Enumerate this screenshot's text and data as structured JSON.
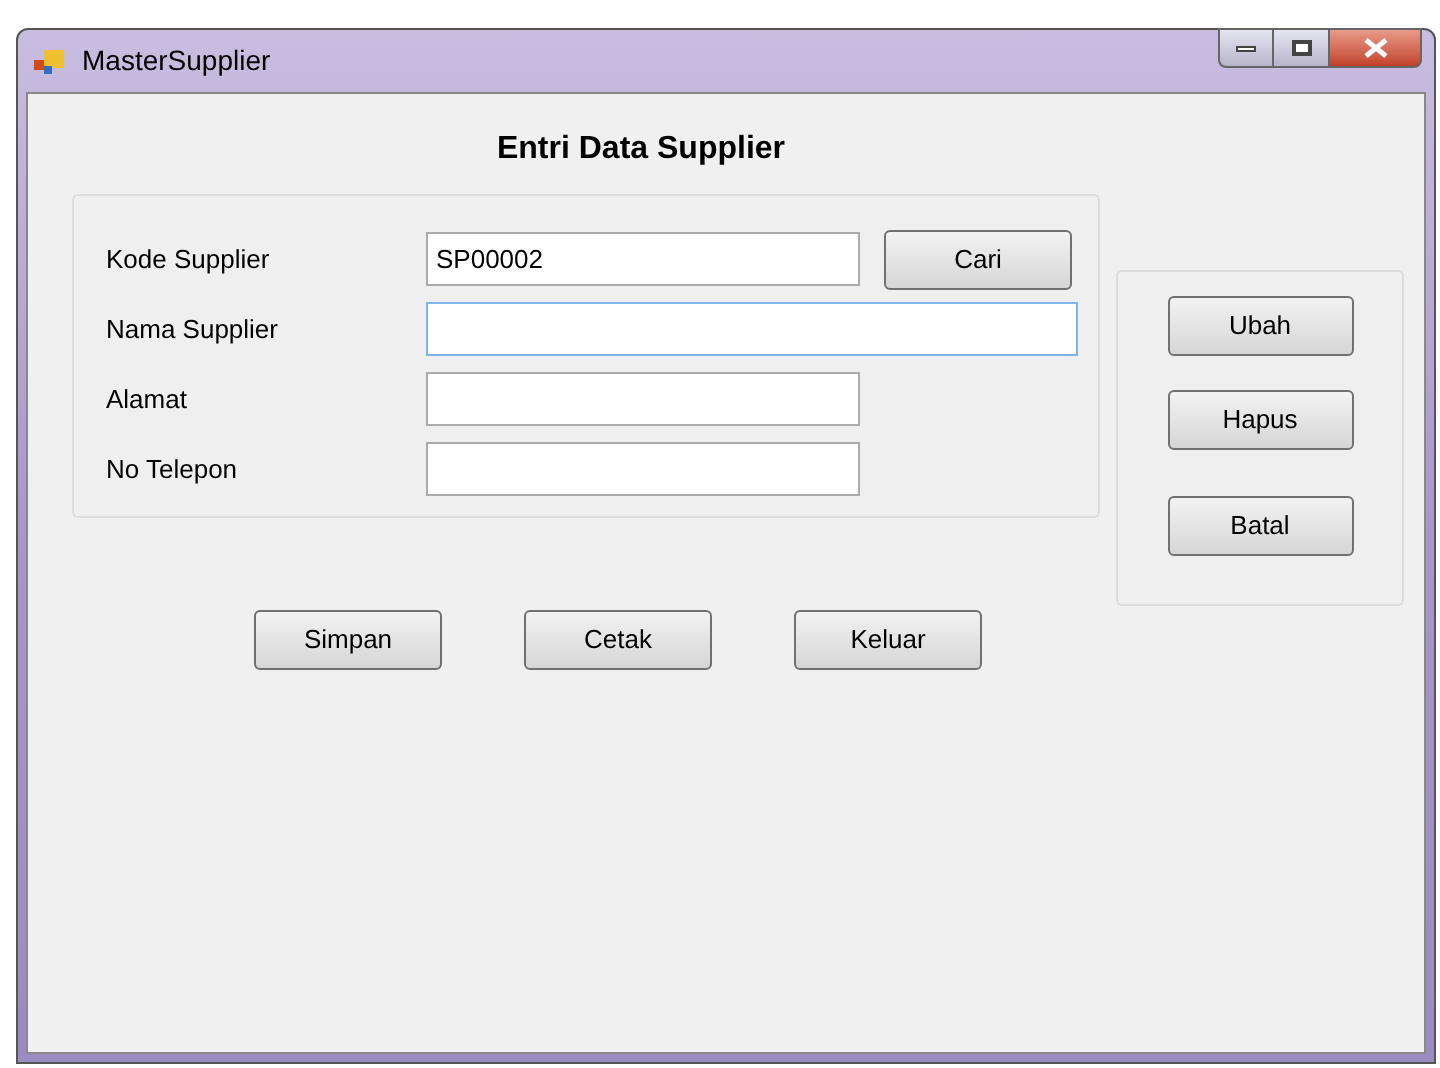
{
  "window": {
    "title": "MasterSupplier"
  },
  "heading": "Entri Data Supplier",
  "fields": [
    {
      "kind": "short",
      "label": "Kode Supplier",
      "value": "SP00002",
      "focused": false
    },
    {
      "kind": "long",
      "label": "Nama Supplier",
      "focused": true
    },
    {
      "kind": "short",
      "label": "Alamat",
      "focused": false
    },
    {
      "kind": "short",
      "label": "No Telepon",
      "focused": false
    }
  ],
  "search_button": "Cari",
  "side_buttons": [
    "Ubah",
    "Hapus",
    "Batal"
  ],
  "bottom_buttons": [
    "Simpan",
    "Cetak",
    "Keluar"
  ]
}
